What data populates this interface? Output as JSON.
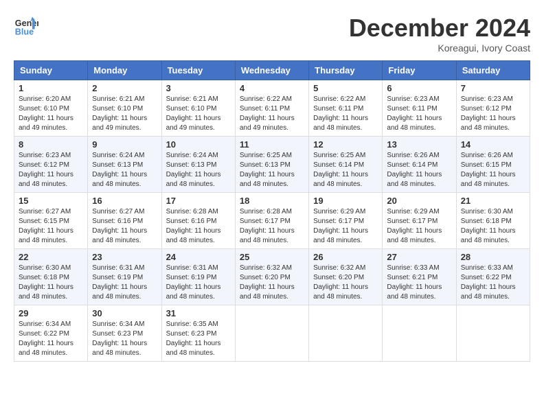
{
  "header": {
    "logo_line1": "General",
    "logo_line2": "Blue",
    "month": "December 2024",
    "location": "Koreagui, Ivory Coast"
  },
  "days_of_week": [
    "Sunday",
    "Monday",
    "Tuesday",
    "Wednesday",
    "Thursday",
    "Friday",
    "Saturday"
  ],
  "weeks": [
    [
      {
        "day": 1,
        "sunrise": "6:20 AM",
        "sunset": "6:10 PM",
        "daylight": "11 hours and 49 minutes."
      },
      {
        "day": 2,
        "sunrise": "6:21 AM",
        "sunset": "6:10 PM",
        "daylight": "11 hours and 49 minutes."
      },
      {
        "day": 3,
        "sunrise": "6:21 AM",
        "sunset": "6:10 PM",
        "daylight": "11 hours and 49 minutes."
      },
      {
        "day": 4,
        "sunrise": "6:22 AM",
        "sunset": "6:11 PM",
        "daylight": "11 hours and 49 minutes."
      },
      {
        "day": 5,
        "sunrise": "6:22 AM",
        "sunset": "6:11 PM",
        "daylight": "11 hours and 48 minutes."
      },
      {
        "day": 6,
        "sunrise": "6:23 AM",
        "sunset": "6:11 PM",
        "daylight": "11 hours and 48 minutes."
      },
      {
        "day": 7,
        "sunrise": "6:23 AM",
        "sunset": "6:12 PM",
        "daylight": "11 hours and 48 minutes."
      }
    ],
    [
      {
        "day": 8,
        "sunrise": "6:23 AM",
        "sunset": "6:12 PM",
        "daylight": "11 hours and 48 minutes."
      },
      {
        "day": 9,
        "sunrise": "6:24 AM",
        "sunset": "6:13 PM",
        "daylight": "11 hours and 48 minutes."
      },
      {
        "day": 10,
        "sunrise": "6:24 AM",
        "sunset": "6:13 PM",
        "daylight": "11 hours and 48 minutes."
      },
      {
        "day": 11,
        "sunrise": "6:25 AM",
        "sunset": "6:13 PM",
        "daylight": "11 hours and 48 minutes."
      },
      {
        "day": 12,
        "sunrise": "6:25 AM",
        "sunset": "6:14 PM",
        "daylight": "11 hours and 48 minutes."
      },
      {
        "day": 13,
        "sunrise": "6:26 AM",
        "sunset": "6:14 PM",
        "daylight": "11 hours and 48 minutes."
      },
      {
        "day": 14,
        "sunrise": "6:26 AM",
        "sunset": "6:15 PM",
        "daylight": "11 hours and 48 minutes."
      }
    ],
    [
      {
        "day": 15,
        "sunrise": "6:27 AM",
        "sunset": "6:15 PM",
        "daylight": "11 hours and 48 minutes."
      },
      {
        "day": 16,
        "sunrise": "6:27 AM",
        "sunset": "6:16 PM",
        "daylight": "11 hours and 48 minutes."
      },
      {
        "day": 17,
        "sunrise": "6:28 AM",
        "sunset": "6:16 PM",
        "daylight": "11 hours and 48 minutes."
      },
      {
        "day": 18,
        "sunrise": "6:28 AM",
        "sunset": "6:17 PM",
        "daylight": "11 hours and 48 minutes."
      },
      {
        "day": 19,
        "sunrise": "6:29 AM",
        "sunset": "6:17 PM",
        "daylight": "11 hours and 48 minutes."
      },
      {
        "day": 20,
        "sunrise": "6:29 AM",
        "sunset": "6:17 PM",
        "daylight": "11 hours and 48 minutes."
      },
      {
        "day": 21,
        "sunrise": "6:30 AM",
        "sunset": "6:18 PM",
        "daylight": "11 hours and 48 minutes."
      }
    ],
    [
      {
        "day": 22,
        "sunrise": "6:30 AM",
        "sunset": "6:18 PM",
        "daylight": "11 hours and 48 minutes."
      },
      {
        "day": 23,
        "sunrise": "6:31 AM",
        "sunset": "6:19 PM",
        "daylight": "11 hours and 48 minutes."
      },
      {
        "day": 24,
        "sunrise": "6:31 AM",
        "sunset": "6:19 PM",
        "daylight": "11 hours and 48 minutes."
      },
      {
        "day": 25,
        "sunrise": "6:32 AM",
        "sunset": "6:20 PM",
        "daylight": "11 hours and 48 minutes."
      },
      {
        "day": 26,
        "sunrise": "6:32 AM",
        "sunset": "6:20 PM",
        "daylight": "11 hours and 48 minutes."
      },
      {
        "day": 27,
        "sunrise": "6:33 AM",
        "sunset": "6:21 PM",
        "daylight": "11 hours and 48 minutes."
      },
      {
        "day": 28,
        "sunrise": "6:33 AM",
        "sunset": "6:22 PM",
        "daylight": "11 hours and 48 minutes."
      }
    ],
    [
      {
        "day": 29,
        "sunrise": "6:34 AM",
        "sunset": "6:22 PM",
        "daylight": "11 hours and 48 minutes."
      },
      {
        "day": 30,
        "sunrise": "6:34 AM",
        "sunset": "6:23 PM",
        "daylight": "11 hours and 48 minutes."
      },
      {
        "day": 31,
        "sunrise": "6:35 AM",
        "sunset": "6:23 PM",
        "daylight": "11 hours and 48 minutes."
      },
      null,
      null,
      null,
      null
    ]
  ]
}
